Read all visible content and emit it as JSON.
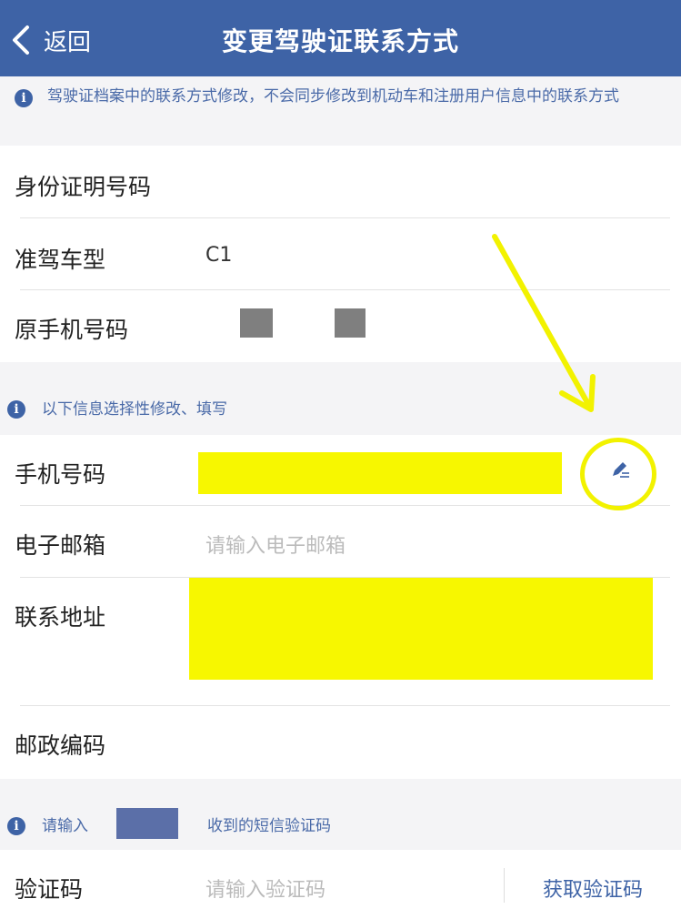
{
  "nav": {
    "back_label": "返回",
    "title": "变更驾驶证联系方式"
  },
  "notice_top": {
    "text": "驾驶证档案中的联系方式修改，不会同步修改到机动车和注册用户信息中的联系方式"
  },
  "info_rows": [
    {
      "label": "身份证明号码",
      "value": ""
    },
    {
      "label": "准驾车型",
      "value": "C1"
    },
    {
      "label": "原手机号码",
      "value": ""
    }
  ],
  "notice_mid": {
    "text": "以下信息选择性修改、填写"
  },
  "edit_rows": {
    "phone": {
      "label": "手机号码",
      "value": ""
    },
    "email": {
      "label": "电子邮箱",
      "placeholder": "请输入电子邮箱"
    },
    "address": {
      "label": "联系地址",
      "value": ""
    },
    "postal": {
      "label": "邮政编码",
      "value": ""
    }
  },
  "notice_sms": {
    "prefix": "请输入",
    "suffix": "收到的短信验证码"
  },
  "verify": {
    "label": "验证码",
    "placeholder": "请输入验证码",
    "get_code_label": "获取验证码"
  },
  "icons": {
    "back": "chevron-left-icon",
    "info": "info-icon",
    "edit": "pencil-edit-icon"
  },
  "colors": {
    "nav_bg": "#3e63a6",
    "link": "#3e63a6",
    "redaction": "#f7f700",
    "annotation": "#f2f200"
  }
}
